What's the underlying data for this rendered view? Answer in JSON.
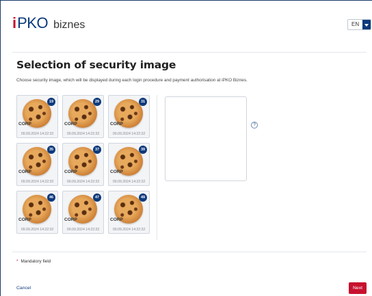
{
  "header": {
    "logo_i": "i",
    "logo_pko": "PKO",
    "logo_suffix": "biznes",
    "language": "EN"
  },
  "page": {
    "title": "Selection of security image",
    "description": "Choose security image, which will be displayed during each login procedure and payment authorisation at iPKO Biznes."
  },
  "images": [
    {
      "number": "19",
      "label": "CORP",
      "stamp": "09.09.2024 14:22:32"
    },
    {
      "number": "29",
      "label": "CORP",
      "stamp": "09.09.2024 14:22:32"
    },
    {
      "number": "31",
      "label": "CORP",
      "stamp": "09.09.2024 14:22:32"
    },
    {
      "number": "35",
      "label": "CORP",
      "stamp": "09.09.2024 14:22:32"
    },
    {
      "number": "37",
      "label": "CORP",
      "stamp": "09.09.2024 14:22:32"
    },
    {
      "number": "39",
      "label": "CORP",
      "stamp": "09.09.2024 14:22:32"
    },
    {
      "number": "46",
      "label": "CORP",
      "stamp": "09.09.2024 14:22:32"
    },
    {
      "number": "47",
      "label": "CORP",
      "stamp": "09.09.2024 14:22:32"
    },
    {
      "number": "49",
      "label": "CORP",
      "stamp": "09.09.2024 14:22:32"
    }
  ],
  "help_glyph": "?",
  "form": {
    "mandatory_marker": "*",
    "mandatory_label": "Mandatory field"
  },
  "actions": {
    "cancel": "Cancel",
    "next": "Next"
  },
  "colors": {
    "brand_navy": "#0d3a7c",
    "brand_red": "#c8102e"
  }
}
